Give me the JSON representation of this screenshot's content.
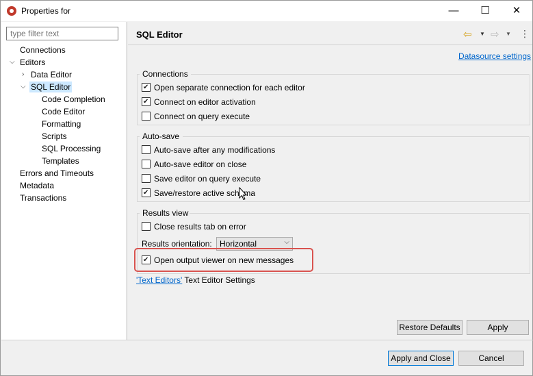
{
  "window": {
    "title": "Properties for",
    "minimize_glyph": "—",
    "maximize_glyph": "☐",
    "close_glyph": "✕"
  },
  "filter": {
    "placeholder": "type filter text"
  },
  "tree": {
    "connections": "Connections",
    "editors": "Editors",
    "data_editor": "Data Editor",
    "sql_editor": "SQL Editor",
    "code_completion": "Code Completion",
    "code_editor": "Code Editor",
    "formatting": "Formatting",
    "scripts": "Scripts",
    "sql_processing": "SQL Processing",
    "templates": "Templates",
    "errors_timeouts": "Errors and Timeouts",
    "metadata": "Metadata",
    "transactions": "Transactions"
  },
  "page": {
    "title": "SQL Editor",
    "datasource_link": "Datasource settings",
    "back_glyph": "⇦",
    "forward_glyph": "⇨",
    "menu_glyph": "⋮"
  },
  "connections_group": {
    "title": "Connections",
    "items": [
      {
        "label": "Open separate connection for each editor",
        "checked": true
      },
      {
        "label": "Connect on editor activation",
        "checked": true
      },
      {
        "label": "Connect on query execute",
        "checked": false
      }
    ]
  },
  "autosave_group": {
    "title": "Auto-save",
    "items": [
      {
        "label": "Auto-save after any modifications",
        "checked": false
      },
      {
        "label": "Auto-save editor on close",
        "checked": false
      },
      {
        "label": "Save editor on query execute",
        "checked": false
      },
      {
        "label": "Save/restore active schema",
        "checked": true
      }
    ]
  },
  "results_group": {
    "title": "Results view",
    "close_tab_label": "Close results tab on error",
    "close_tab_checked": false,
    "orientation_label": "Results orientation:",
    "orientation_value": "Horizontal",
    "output_viewer_label": "Open output viewer on new messages",
    "output_viewer_checked": true
  },
  "text_editors": {
    "link": "'Text Editors'",
    "suffix": "Text Editor Settings"
  },
  "buttons": {
    "restore_defaults": "Restore Defaults",
    "apply": "Apply",
    "apply_close": "Apply and Close",
    "cancel": "Cancel"
  },
  "colors": {
    "highlight_border": "#d9534f",
    "link": "#0066cc",
    "selection": "#cce8ff",
    "primary_button_border": "#0078d7"
  }
}
